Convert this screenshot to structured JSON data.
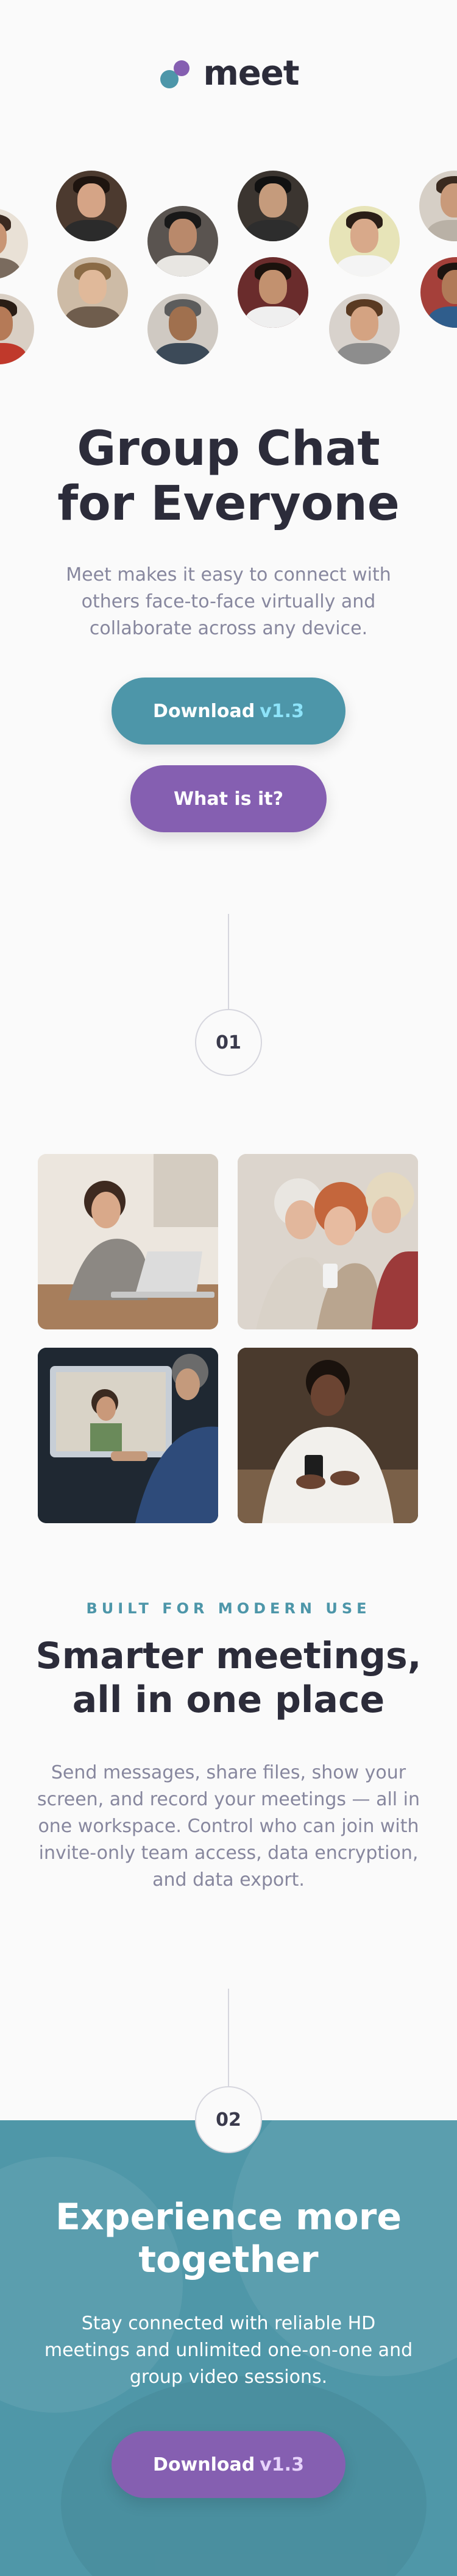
{
  "brand": {
    "name": "meet",
    "colors": {
      "primary": "#4d96a9",
      "secondary": "#855fb1"
    }
  },
  "hero": {
    "title_line1": "Group Chat",
    "title_line2": "for Everyone",
    "text": "Meet makes it easy to connect with others face-to-face virtually and collaborate across any device.",
    "download_label": "Download",
    "download_version": "v1.3",
    "what_label": "What is it?"
  },
  "steps": {
    "first": "01",
    "second": "02"
  },
  "features": {
    "eyebrow": "BUILT FOR MODERN USE",
    "title_line1": "Smarter meetings,",
    "title_line2": "all in one place",
    "text": "Send messages, share files, show your screen, and record your meetings — all in one workspace. Control who can join with invite-only team access, data encryption, and data export."
  },
  "cta": {
    "title_line1": "Experience more",
    "title_line2": "together",
    "text": "Stay connected with reliable HD meetings and unlimited one-on-one and group video sessions.",
    "download_label": "Download",
    "download_version": "v1.3"
  }
}
